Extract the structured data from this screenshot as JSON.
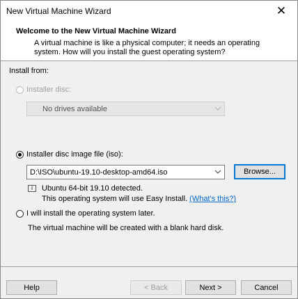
{
  "window": {
    "title": "New Virtual Machine Wizard",
    "close_symbol": "✕"
  },
  "header": {
    "title": "Welcome to the New Virtual Machine Wizard",
    "description": "A virtual machine is like a physical computer; it needs an operating system. How will you install the guest operating system?"
  },
  "install_from": {
    "label": "Install from:",
    "installer_disc": {
      "label": "Installer disc:",
      "selected": false,
      "enabled": false,
      "drive_value": "No drives available"
    },
    "iso": {
      "label": "Installer disc image file (iso):",
      "selected": true,
      "path_value": "D:\\ISO\\ubuntu-19.10-desktop-amd64.iso",
      "browse_label": "Browse...",
      "detected_text": "Ubuntu 64-bit 19.10 detected.",
      "easy_install_text": "This operating system will use Easy Install.",
      "whats_this_link": "(What's this?)"
    },
    "later": {
      "label": "I will install the operating system later.",
      "selected": false,
      "note": "The virtual machine will be created with a blank hard disk."
    }
  },
  "footer": {
    "help": "Help",
    "back": "< Back",
    "next": "Next >",
    "cancel": "Cancel"
  },
  "icons": {
    "close": "close-icon",
    "info": "info-icon",
    "dropdown": "chevron-down-icon"
  }
}
